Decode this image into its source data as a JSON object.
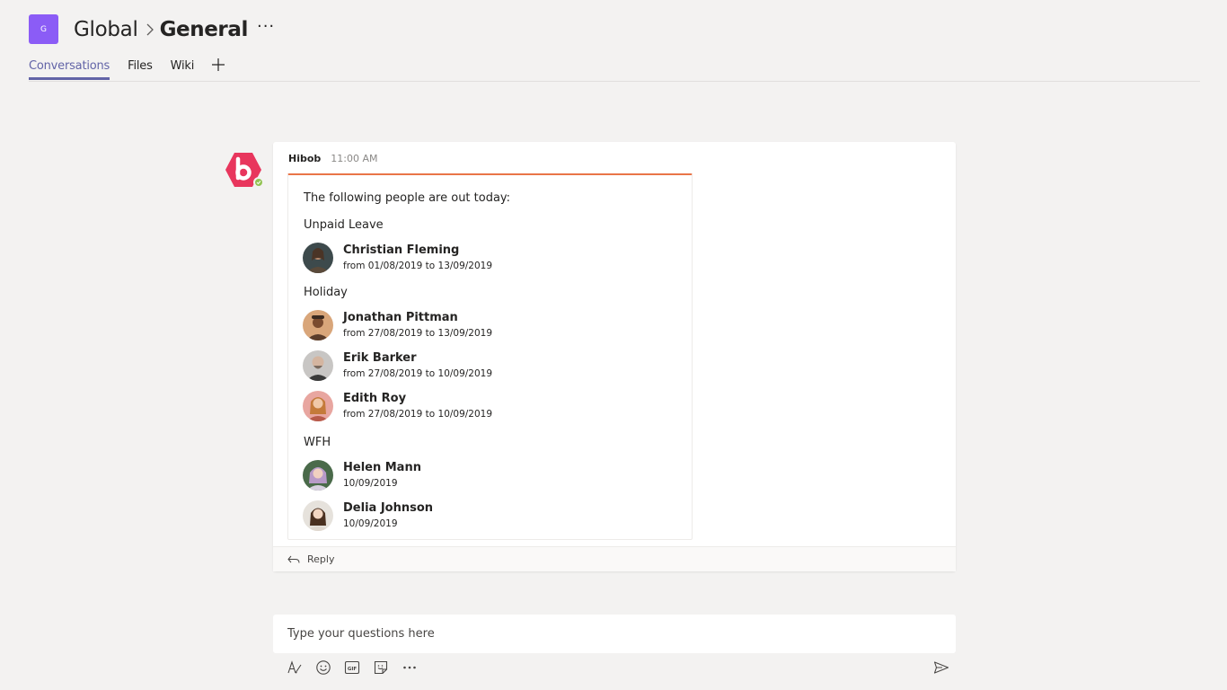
{
  "header": {
    "team_badge": "G",
    "team_name": "Global",
    "channel_name": "General",
    "more_label": "···"
  },
  "tabs": [
    {
      "label": "Conversations",
      "active": true
    },
    {
      "label": "Files",
      "active": false
    },
    {
      "label": "Wiki",
      "active": false
    }
  ],
  "message": {
    "sender": "Hibob",
    "time": "11:00 AM",
    "accent_color": "#e97548",
    "card": {
      "intro": "The following people are out today:",
      "groups": [
        {
          "title": "Unpaid Leave",
          "people": [
            {
              "name": "Christian Fleming",
              "dates": "from 01/08/2019 to 13/09/2019"
            }
          ]
        },
        {
          "title": "Holiday",
          "people": [
            {
              "name": "Jonathan Pittman",
              "dates": "from 27/08/2019 to 13/09/2019"
            },
            {
              "name": "Erik Barker",
              "dates": "from 27/08/2019 to 10/09/2019"
            },
            {
              "name": "Edith Roy",
              "dates": "from 27/08/2019 to 10/09/2019"
            }
          ]
        },
        {
          "title": "WFH",
          "people": [
            {
              "name": "Helen Mann",
              "dates": "10/09/2019"
            },
            {
              "name": "Delia Johnson",
              "dates": "10/09/2019"
            }
          ]
        }
      ]
    },
    "reply_label": "Reply"
  },
  "compose": {
    "placeholder": "Type your questions here",
    "toolbar_icons": [
      "format-icon",
      "emoji-icon",
      "gif-icon",
      "sticker-icon",
      "more-options-icon"
    ],
    "send_icon": "send-icon"
  },
  "colors": {
    "accent": "#6264a7",
    "team_badge": "#8b5cf6",
    "bot_brand": "#e8365d",
    "presence": "#92c353"
  }
}
